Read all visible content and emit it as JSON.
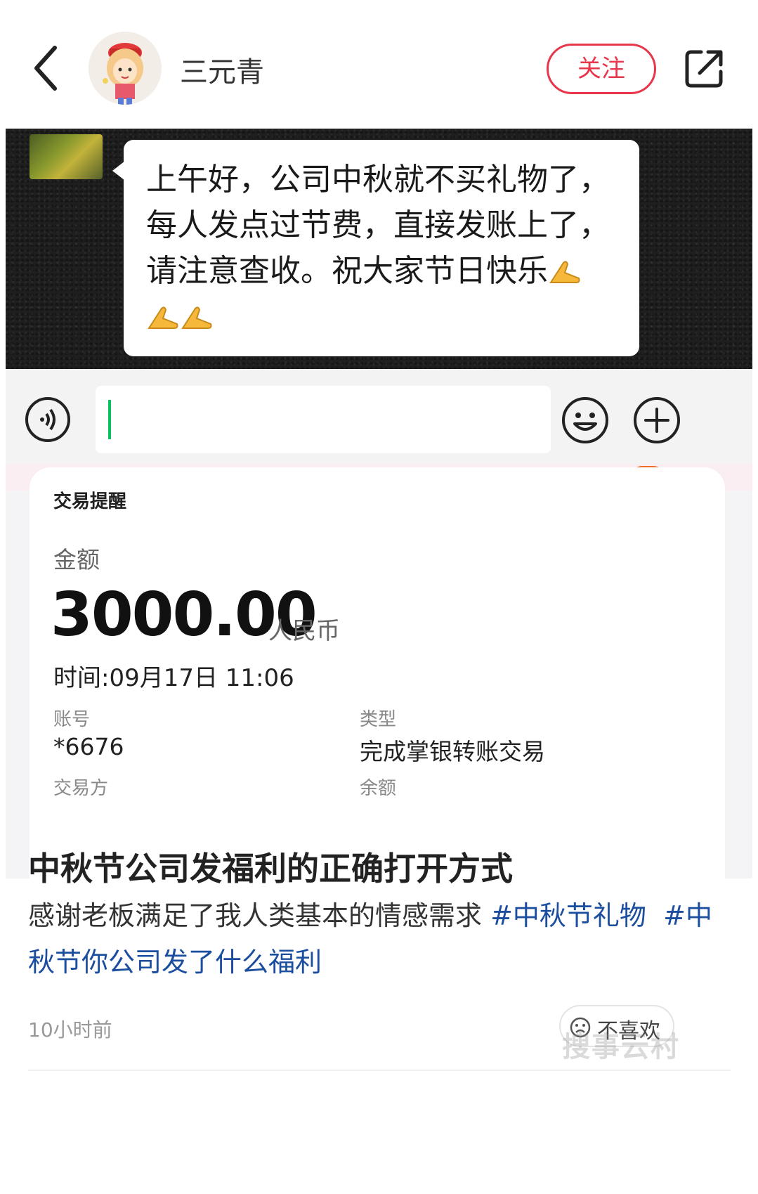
{
  "header": {
    "username": "三元青",
    "follow_label": "关注"
  },
  "chat": {
    "message_lines": [
      "上午好，公司中秋就不买礼物了，",
      "每人发点过节费，直接发账上了，",
      "请注意查收。祝大家节日快乐"
    ],
    "emoji": "folded-hands"
  },
  "transaction": {
    "title": "交易提醒",
    "amount_label": "金额",
    "amount": "3000.00",
    "currency": "人民币",
    "time": "时间:09月17日 11:06",
    "account_label": "账号",
    "account_value": "*6676",
    "type_label": "类型",
    "type_value": "完成掌银转账交易",
    "counterparty_label": "交易方",
    "balance_label": "余额"
  },
  "post": {
    "title": "中秋节公司发福利的正确打开方式",
    "body_text": "感谢老板满足了我人类基本的情感需求 ",
    "tag1": "#中秋节礼物",
    "tag2": "#中秋节你公司发了什么福利",
    "time": "10小时前",
    "dislike_label": "不喜欢"
  },
  "watermark": "搜事云村",
  "colors": {
    "accent_red": "#e8364a",
    "tag_blue": "#1b4e9e",
    "wechat_green": "#07c160"
  }
}
